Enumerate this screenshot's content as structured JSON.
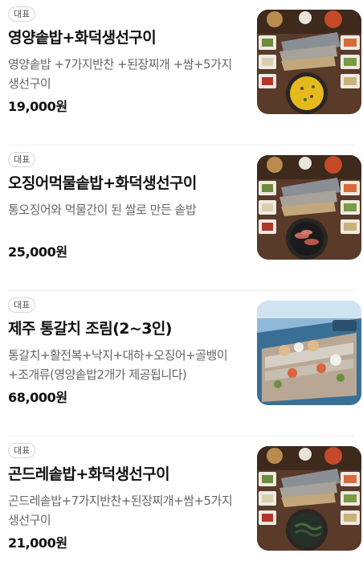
{
  "menu": {
    "items": [
      {
        "badge": "대표",
        "title": "영양솥밥+화덕생선구이",
        "description": "영양솥밥 +7가지반찬 +된장찌개 +쌈+5가지 생선구이",
        "price": "19,000원",
        "image_icon": "grilled-fish-rice-set-photo"
      },
      {
        "badge": "대표",
        "title": "오징어먹물솥밥+화덕생선구이",
        "description": "통오징어와 먹물간이 된 쌀로 만든 솥밥",
        "price": "25,000원",
        "image_icon": "squid-ink-rice-set-photo"
      },
      {
        "badge": "대표",
        "title": "제주 통갈치 조림(2~3인)",
        "description": "통갈치+활전복+낙지+대하+오징어+골뱅이+조개류(영양솥밥2개가 제공됩니다)",
        "price": "68,000원",
        "image_icon": "braised-hairtail-photo"
      },
      {
        "badge": "대표",
        "title": "곤드레솥밥+화덕생선구이",
        "description": "곤드레솥밥+7가지반찬+된장찌개+쌈+5가지 생선구이",
        "price": "21,000원",
        "image_icon": "gondre-rice-set-photo"
      }
    ]
  }
}
